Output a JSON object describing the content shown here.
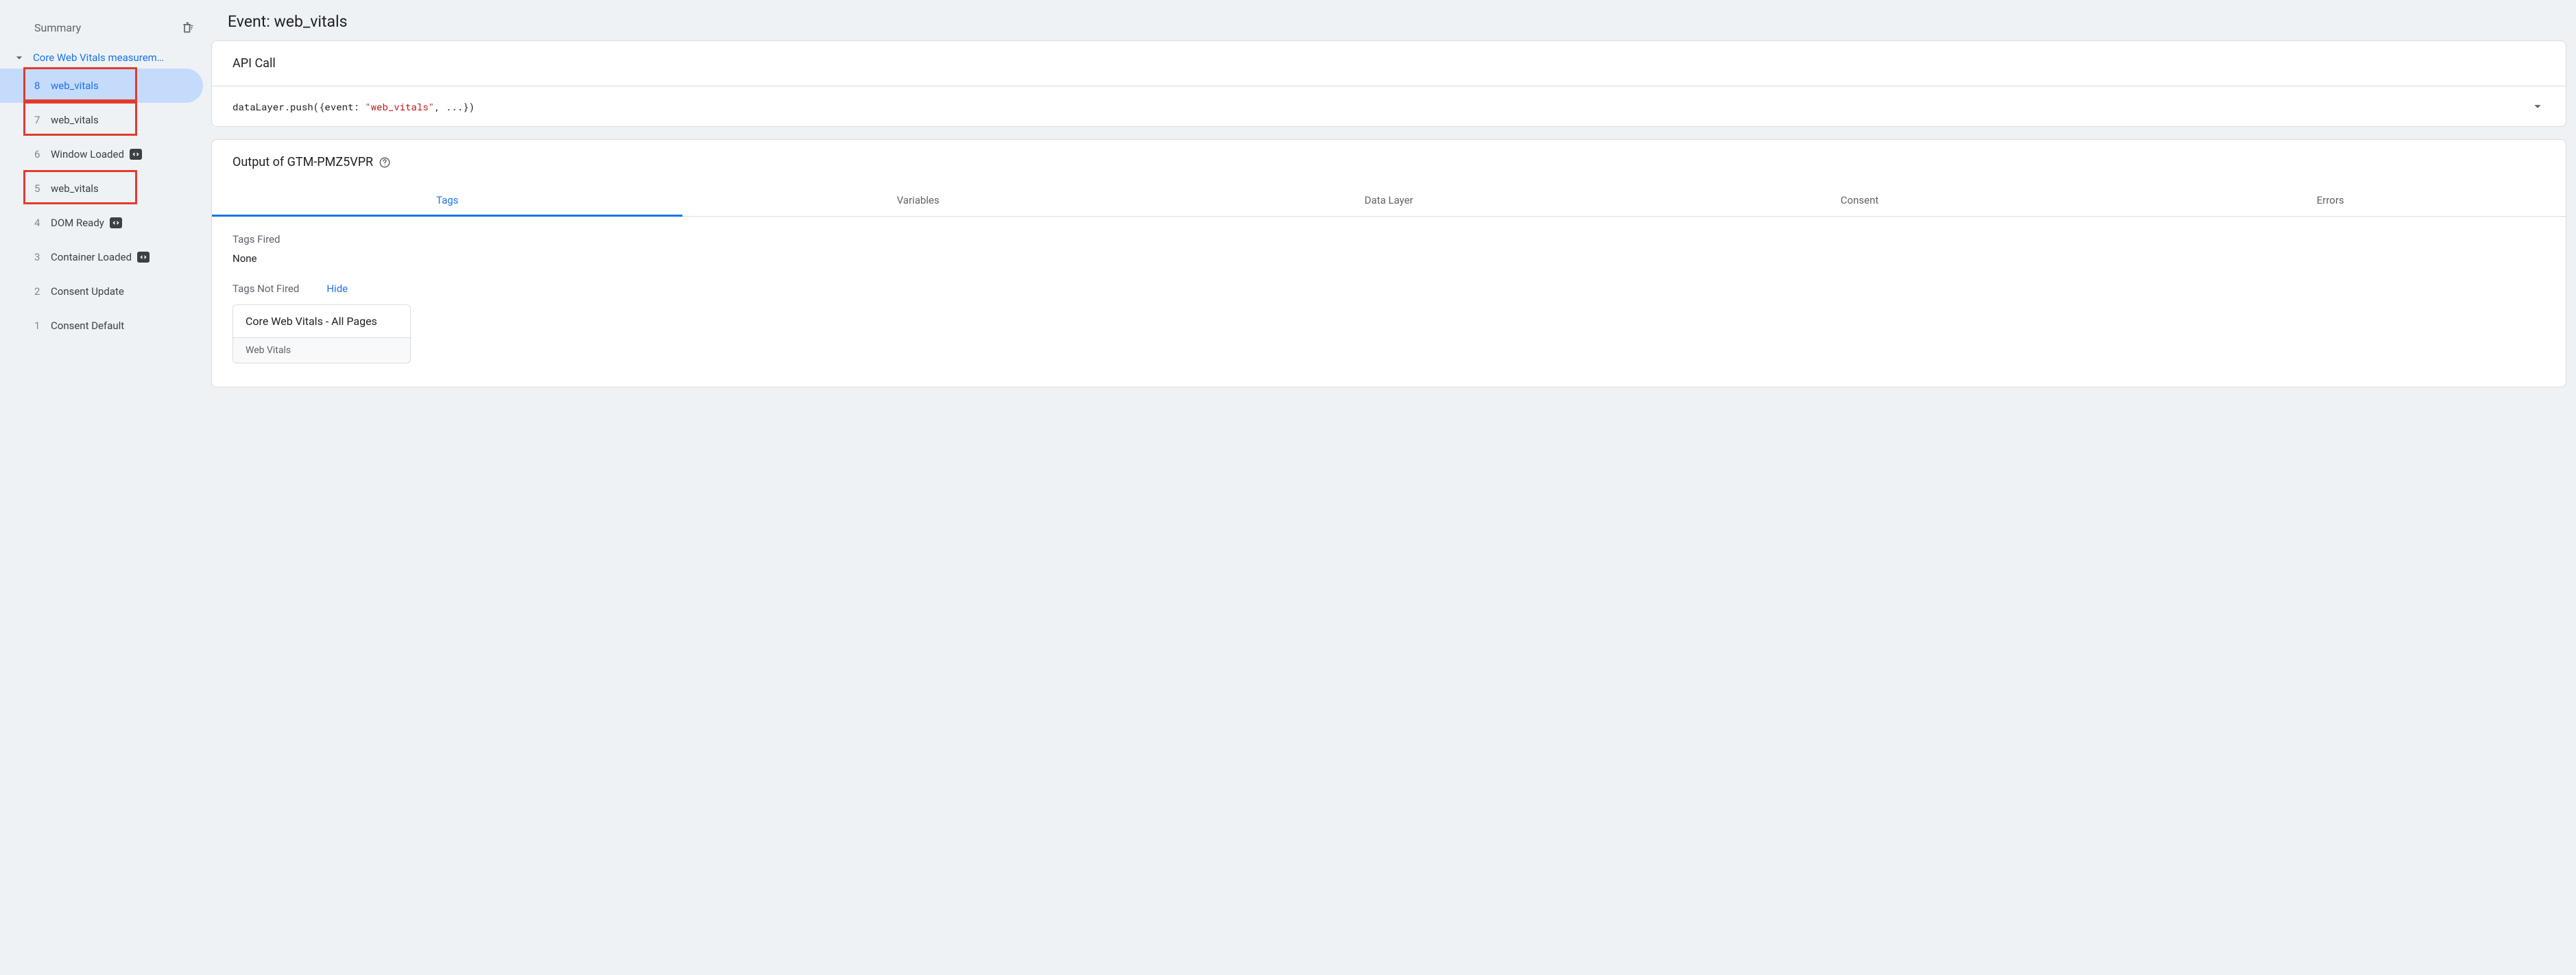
{
  "sidebar": {
    "summary_label": "Summary",
    "session_title": "Core Web Vitals measurem…",
    "events": [
      {
        "num": "8",
        "label": "web_vitals",
        "active": true,
        "badge": false,
        "highlight": true
      },
      {
        "num": "7",
        "label": "web_vitals",
        "active": false,
        "badge": false,
        "highlight": true
      },
      {
        "num": "6",
        "label": "Window Loaded",
        "active": false,
        "badge": true,
        "highlight": false
      },
      {
        "num": "5",
        "label": "web_vitals",
        "active": false,
        "badge": false,
        "highlight": true
      },
      {
        "num": "4",
        "label": "DOM Ready",
        "active": false,
        "badge": true,
        "highlight": false
      },
      {
        "num": "3",
        "label": "Container Loaded",
        "active": false,
        "badge": true,
        "highlight": false
      },
      {
        "num": "2",
        "label": "Consent Update",
        "active": false,
        "badge": false,
        "highlight": false
      },
      {
        "num": "1",
        "label": "Consent Default",
        "active": false,
        "badge": false,
        "highlight": false
      }
    ]
  },
  "main": {
    "title": "Event: web_vitals",
    "api_call": {
      "header": "API Call",
      "code_prefix": "dataLayer.push({event: ",
      "code_string": "\"web_vitals\"",
      "code_suffix": ", ...})"
    },
    "output": {
      "header": "Output of GTM-PMZ5VPR",
      "tabs": [
        "Tags",
        "Variables",
        "Data Layer",
        "Consent",
        "Errors"
      ],
      "active_tab": 0,
      "fired_label": "Tags Fired",
      "fired_value": "None",
      "not_fired_label": "Tags Not Fired",
      "hide_label": "Hide",
      "not_fired_tags": [
        {
          "name": "Core Web Vitals - All Pages",
          "type": "Web Vitals"
        }
      ]
    }
  }
}
